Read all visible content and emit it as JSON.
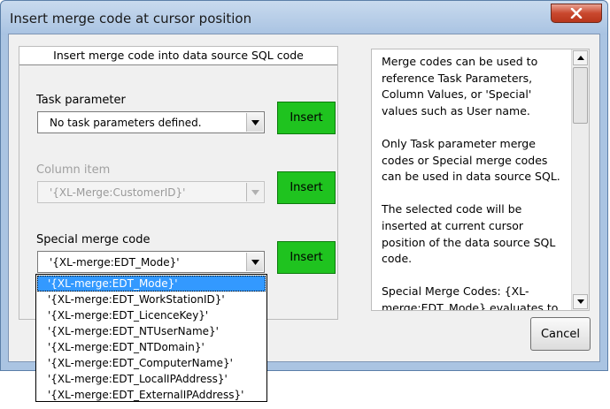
{
  "window": {
    "title": "Insert merge code at cursor position"
  },
  "group": {
    "header": "Insert merge code into data source SQL code",
    "task_parameter": {
      "label": "Task parameter",
      "value": "No task parameters defined.",
      "button": "Insert"
    },
    "column_item": {
      "label": "Column item",
      "value": "'{XL-Merge:CustomerID}'",
      "button": "Insert"
    },
    "special_merge": {
      "label": "Special merge code",
      "value": "'{XL-merge:EDT_Mode}'",
      "button": "Insert",
      "options": [
        "'{XL-merge:EDT_Mode}'",
        "'{XL-merge:EDT_WorkStationID}'",
        "'{XL-merge:EDT_LicenceKey}'",
        "'{XL-merge:EDT_NTUserName}'",
        "'{XL-merge:EDT_NTDomain}'",
        "'{XL-merge:EDT_ComputerName}'",
        "'{XL-merge:EDT_LocalIPAddress}'",
        "'{XL-merge:EDT_ExternalIPAddress}'"
      ],
      "selected_index": 0
    }
  },
  "info": {
    "paragraphs": [
      "Merge codes can be used to reference Task Parameters, Column Values, or 'Special' values such as User name.",
      "Only Task parameter merge codes or Special merge codes can be used in data source SQL.",
      "The selected code will be inserted at current cursor position of the data source SQL code.",
      "Special Merge Codes: {XL-merge:EDT_Mode} evaluates to either 'VALIDATE' or 'SEND'"
    ]
  },
  "buttons": {
    "cancel": "Cancel"
  },
  "colors": {
    "insert_green": "#1fc31f",
    "selection_blue": "#3399ff",
    "close_red": "#c9482e"
  },
  "icons": [
    "close-icon",
    "chevron-down-icon",
    "scroll-up-icon",
    "scroll-down-icon"
  ]
}
